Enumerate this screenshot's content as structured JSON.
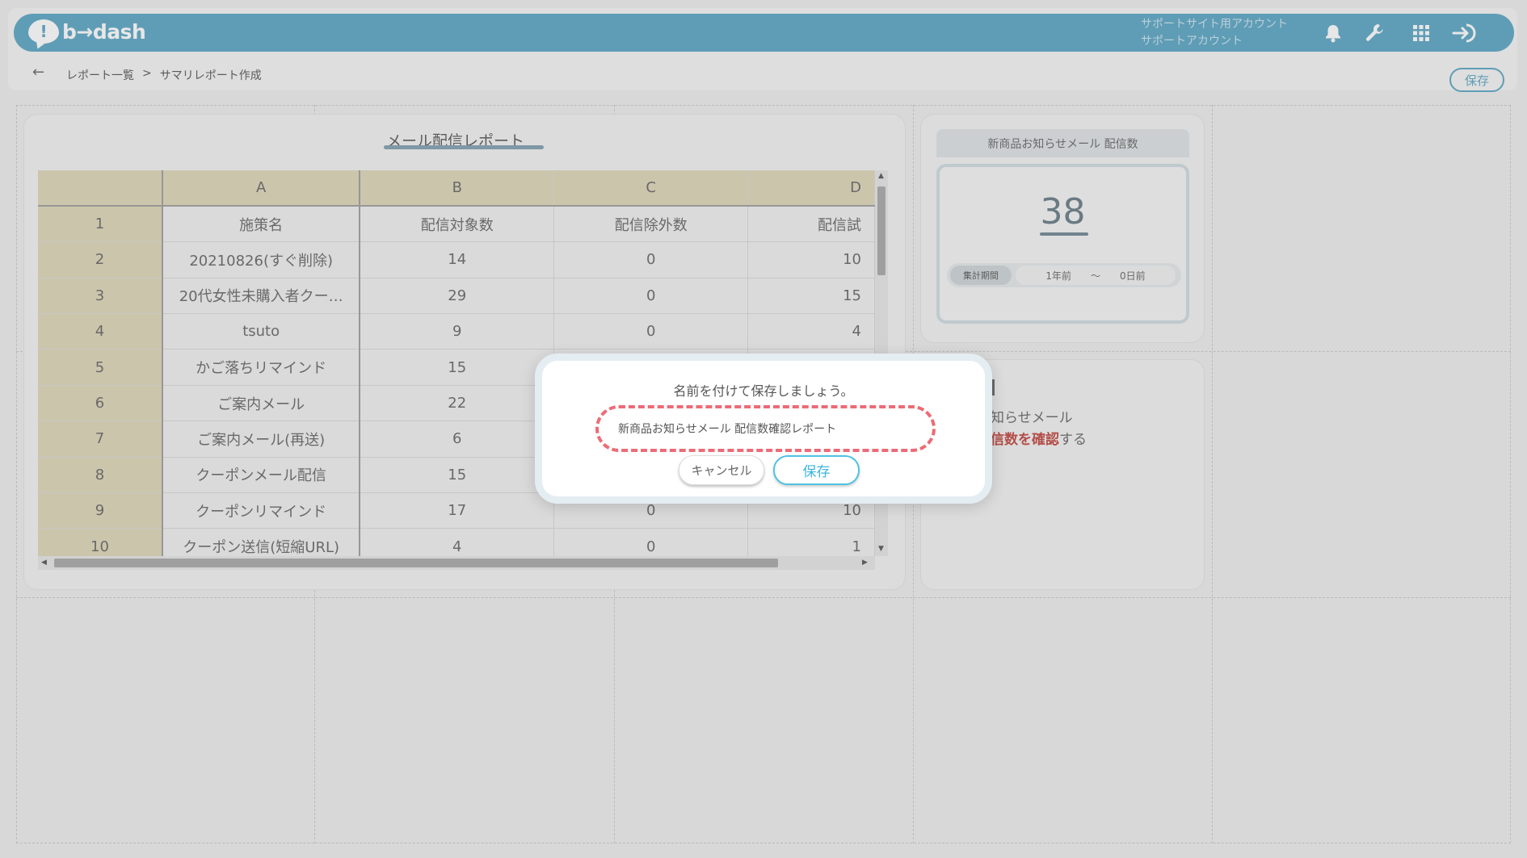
{
  "app": {
    "logo_text": "b→dash",
    "account_line1": "サポートサイト用アカウント",
    "account_line2": "サポートアカウント"
  },
  "header_icons": [
    "bell-icon",
    "wrench-icon",
    "grid-icon",
    "logout-icon"
  ],
  "breadcrumb": {
    "back_icon": "←",
    "parent": "レポート一覧",
    "separator": ">",
    "current": "サマリレポート作成",
    "save_label": "保存"
  },
  "sheet": {
    "title": "メール配信レポート",
    "columns": [
      "A",
      "B",
      "C",
      "D"
    ],
    "rows": [
      {
        "num": "1",
        "a": "施策名",
        "b": "配信対象数",
        "c": "配信除外数",
        "d": "配信試"
      },
      {
        "num": "2",
        "a": "20210826(すぐ削除)",
        "b": "14",
        "c": "0",
        "d": "10"
      },
      {
        "num": "3",
        "a": "20代女性未購入者クー…",
        "b": "29",
        "c": "0",
        "d": "15"
      },
      {
        "num": "4",
        "a": "tsuto",
        "b": "9",
        "c": "0",
        "d": "4"
      },
      {
        "num": "5",
        "a": "かご落ちリマインド",
        "b": "15",
        "c": "",
        "d": ""
      },
      {
        "num": "6",
        "a": "ご案内メール",
        "b": "22",
        "c": "",
        "d": ""
      },
      {
        "num": "7",
        "a": "ご案内メール(再送)",
        "b": "6",
        "c": "",
        "d": ""
      },
      {
        "num": "8",
        "a": "クーポンメール配信",
        "b": "15",
        "c": "",
        "d": ""
      },
      {
        "num": "9",
        "a": "クーポンリマインド",
        "b": "17",
        "c": "0",
        "d": "10"
      },
      {
        "num": "10",
        "a": "クーポン送信(短縮URL)",
        "b": "4",
        "c": "0",
        "d": "1"
      }
    ]
  },
  "metric": {
    "title": "新商品お知らせメール 配信数",
    "value": "38",
    "period_label": "集計期間",
    "period_from": "1年前",
    "period_sep": "〜",
    "period_to": "0日前"
  },
  "hidden_card": {
    "line1": "知らせメール",
    "line2_red": "信数を確認",
    "line2_rest": "する"
  },
  "dialog": {
    "message": "名前を付けて保存しましょう。",
    "name_value": "新商品お知らせメール 配信数確認レポート",
    "cancel_label": "キャンセル",
    "save_label": "保存"
  }
}
